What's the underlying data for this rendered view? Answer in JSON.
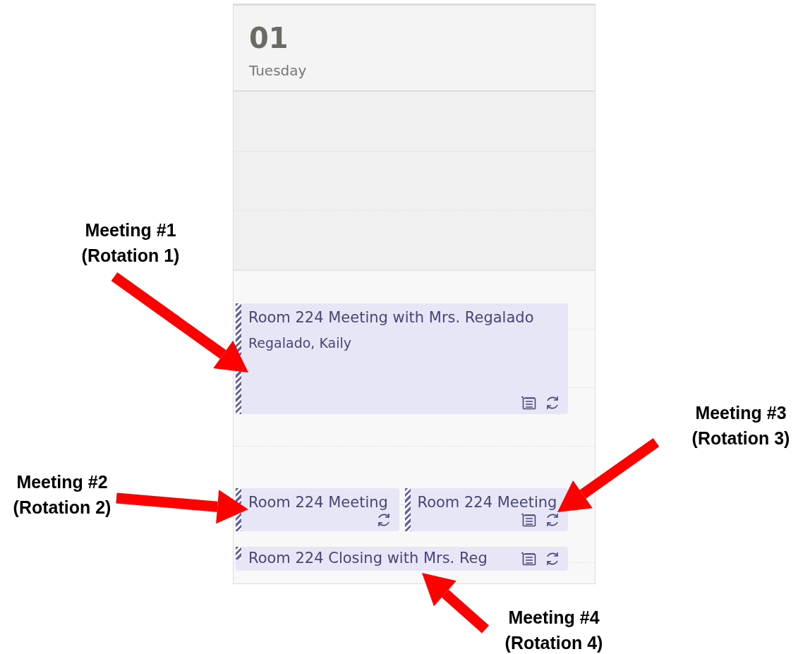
{
  "day": {
    "number": "01",
    "weekday": "Tuesday"
  },
  "event_rows": [
    {
      "events": [
        {
          "title": "Room 224 Meeting with Mrs. Regalado",
          "organizer": "Regalado, Kaily",
          "notes": true,
          "recurring": true
        }
      ]
    },
    {
      "events": [
        {
          "title": "Room 224 Meeting",
          "notes": false,
          "recurring": true
        },
        {
          "title": "Room 224 Meeting",
          "notes": true,
          "recurring": true
        }
      ]
    },
    {
      "events": [
        {
          "title": "Room 224 Closing with Mrs. Reg",
          "notes": true,
          "recurring": true
        }
      ]
    }
  ],
  "annotations": [
    {
      "label": "Meeting #1",
      "sublabel": "(Rotation 1)"
    },
    {
      "label": "Meeting #2",
      "sublabel": "(Rotation 2)"
    },
    {
      "label": "Meeting #3",
      "sublabel": "(Rotation 3)"
    },
    {
      "label": "Meeting #4",
      "sublabel": "(Rotation 4)"
    }
  ]
}
